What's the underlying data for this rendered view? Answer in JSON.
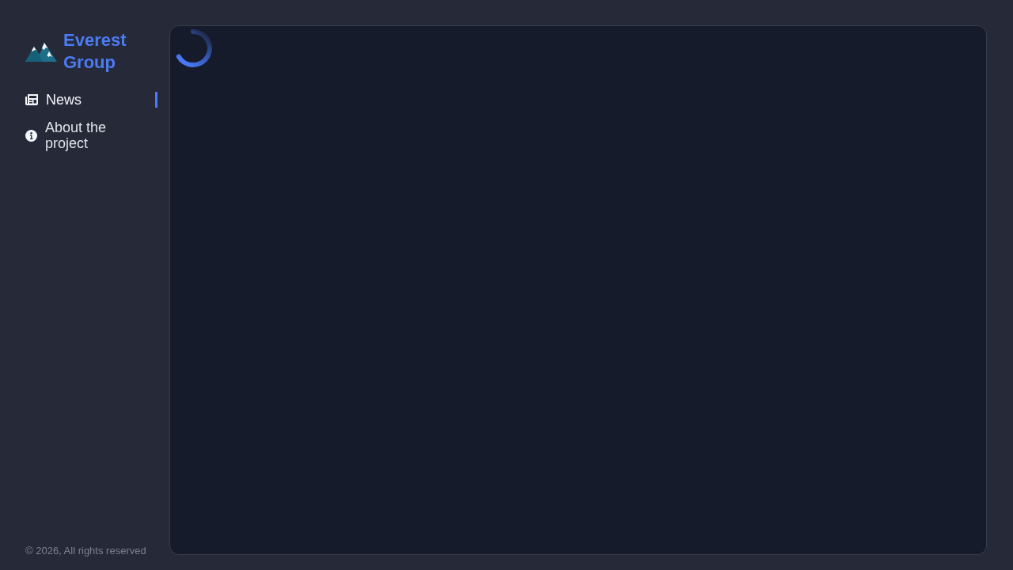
{
  "brand": {
    "name": "Everest Group"
  },
  "nav": [
    {
      "kind": "news",
      "label": "News",
      "selected": true
    },
    {
      "kind": "info",
      "label": "About the project",
      "selected": false
    }
  ],
  "footer": {
    "text": "© 2026, All rights reserved"
  },
  "main": {
    "loading": true
  }
}
